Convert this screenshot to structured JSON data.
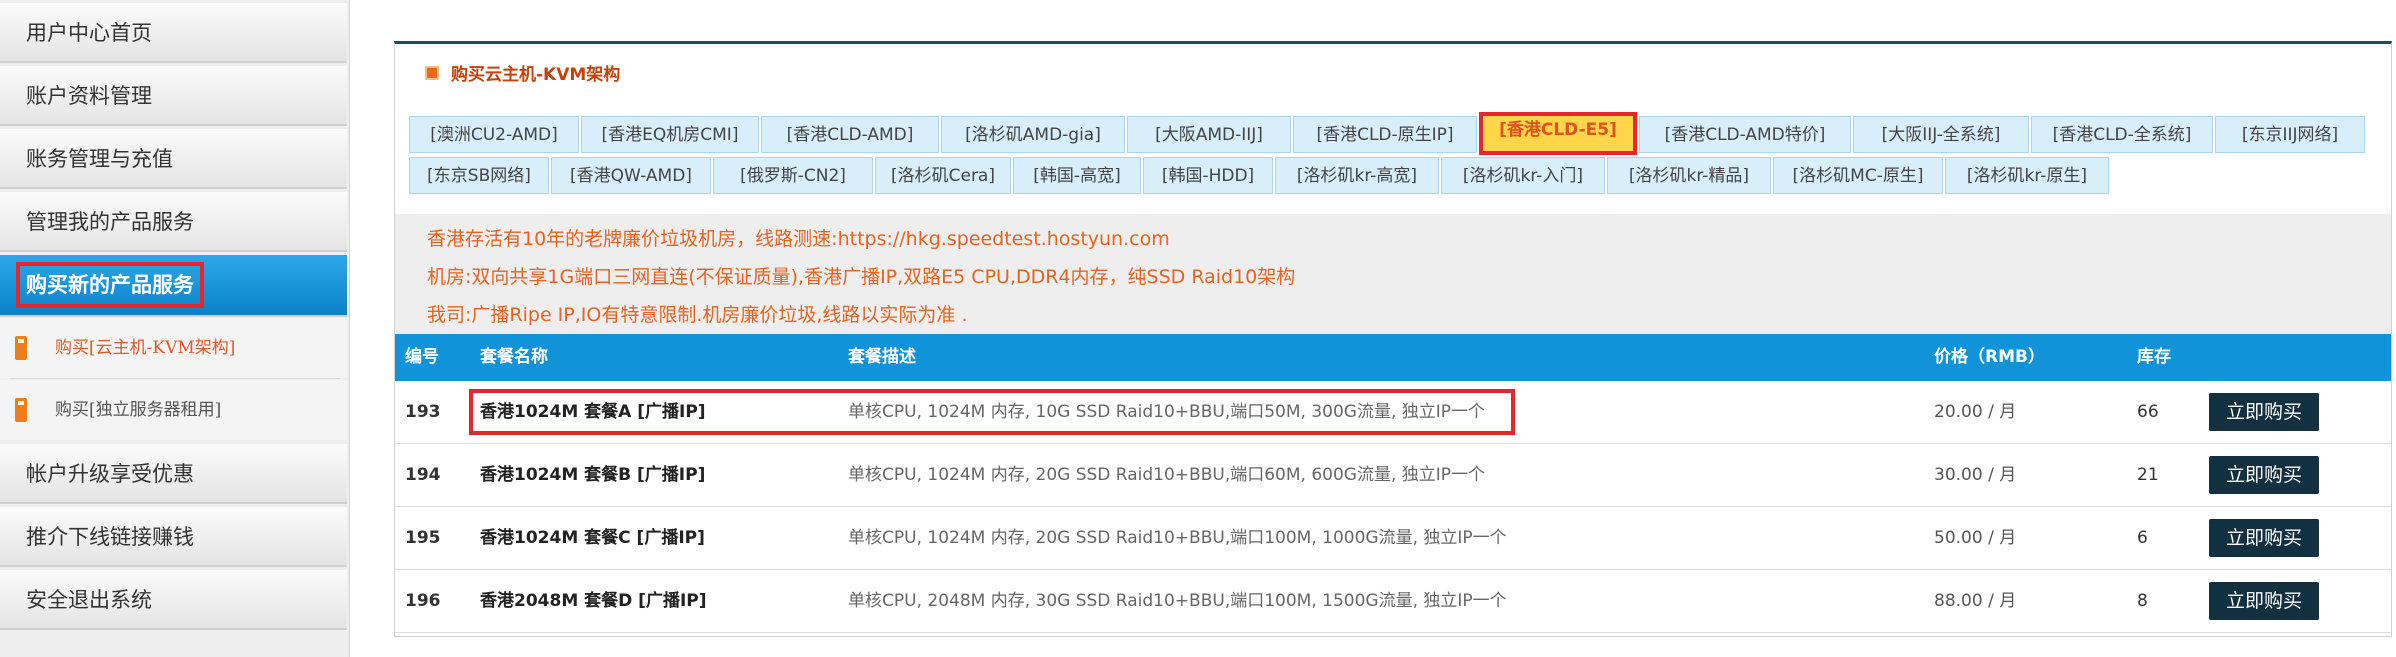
{
  "sidebar": {
    "items": [
      {
        "label": "用户中心首页"
      },
      {
        "label": "账户资料管理"
      },
      {
        "label": "账务管理与充值"
      },
      {
        "label": "管理我的产品服务"
      },
      {
        "label": "购买新的产品服务"
      },
      {
        "label": "帐户升级享受优惠"
      },
      {
        "label": "推介下线链接赚钱"
      },
      {
        "label": "安全退出系统"
      }
    ],
    "submenu": [
      {
        "label": "购买[云主机-KVM架构]"
      },
      {
        "label": "购买[独立服务器租用]"
      }
    ]
  },
  "panel": {
    "title": "购买云主机-KVM架构",
    "tabs": [
      "[澳洲CU2-AMD]",
      "[香港EQ机房CMI]",
      "[香港CLD-AMD]",
      "[洛杉矶AMD-gia]",
      "[大阪AMD-IIJ]",
      "[香港CLD-原生IP]",
      "[香港CLD-E5]",
      "[香港CLD-AMD特价]",
      "[大阪IIJ-全系统]",
      "[香港CLD-全系统]",
      "[东京IIJ网络]",
      "[东京SB网络]",
      "[香港QW-AMD]",
      "[俄罗斯-CN2]",
      "[洛杉矶Cera]",
      "[韩国-高宽]",
      "[韩国-HDD]",
      "[洛杉矶kr-高宽]",
      "[洛杉矶kr-入门]",
      "[洛杉矶kr-精品]",
      "[洛杉矶MC-原生]",
      "[洛杉矶kr-原生]"
    ],
    "selected_tab": "[香港CLD-E5]",
    "info_lines": [
      "香港存活有10年的老牌廉价垃圾机房，线路测速:https://hkg.speedtest.hostyun.com",
      "机房:双向共享1G端口三网直连(不保证质量),香港广播IP,双路E5 CPU,DDR4内存，纯SSD Raid10架构",
      "我司:广播Ripe IP,IO有特意限制.机房廉价垃圾,线路以实际为准 ."
    ]
  },
  "table": {
    "headers": {
      "id": "编号",
      "name": "套餐名称",
      "desc": "套餐描述",
      "price": "价格（RMB）",
      "stock": "库存"
    },
    "rows": [
      {
        "id": "193",
        "name": "香港1024M 套餐A [广播IP]",
        "desc": "单核CPU, 1024M 内存, 10G SSD Raid10+BBU,端口50M, 300G流量, 独立IP一个",
        "price": "20.00 / 月",
        "stock": "66",
        "action": "立即购买"
      },
      {
        "id": "194",
        "name": "香港1024M 套餐B [广播IP]",
        "desc": "单核CPU, 1024M 内存, 20G SSD Raid10+BBU,端口60M, 600G流量, 独立IP一个",
        "price": "30.00 / 月",
        "stock": "21",
        "action": "立即购买"
      },
      {
        "id": "195",
        "name": "香港1024M 套餐C [广播IP]",
        "desc": "单核CPU, 1024M 内存, 20G SSD Raid10+BBU,端口100M, 1000G流量, 独立IP一个",
        "price": "50.00 / 月",
        "stock": "6",
        "action": "立即购买"
      },
      {
        "id": "196",
        "name": "香港2048M 套餐D [广播IP]",
        "desc": "单核CPU, 2048M 内存, 30G SSD Raid10+BBU,端口100M, 1500G流量, 独立IP一个",
        "price": "88.00 / 月",
        "stock": "8",
        "action": "立即购买"
      }
    ]
  },
  "colors": {
    "accent": "#1193da",
    "highlight": "#e5262c",
    "info_text": "#e8631f",
    "buy_button": "#12303f"
  }
}
